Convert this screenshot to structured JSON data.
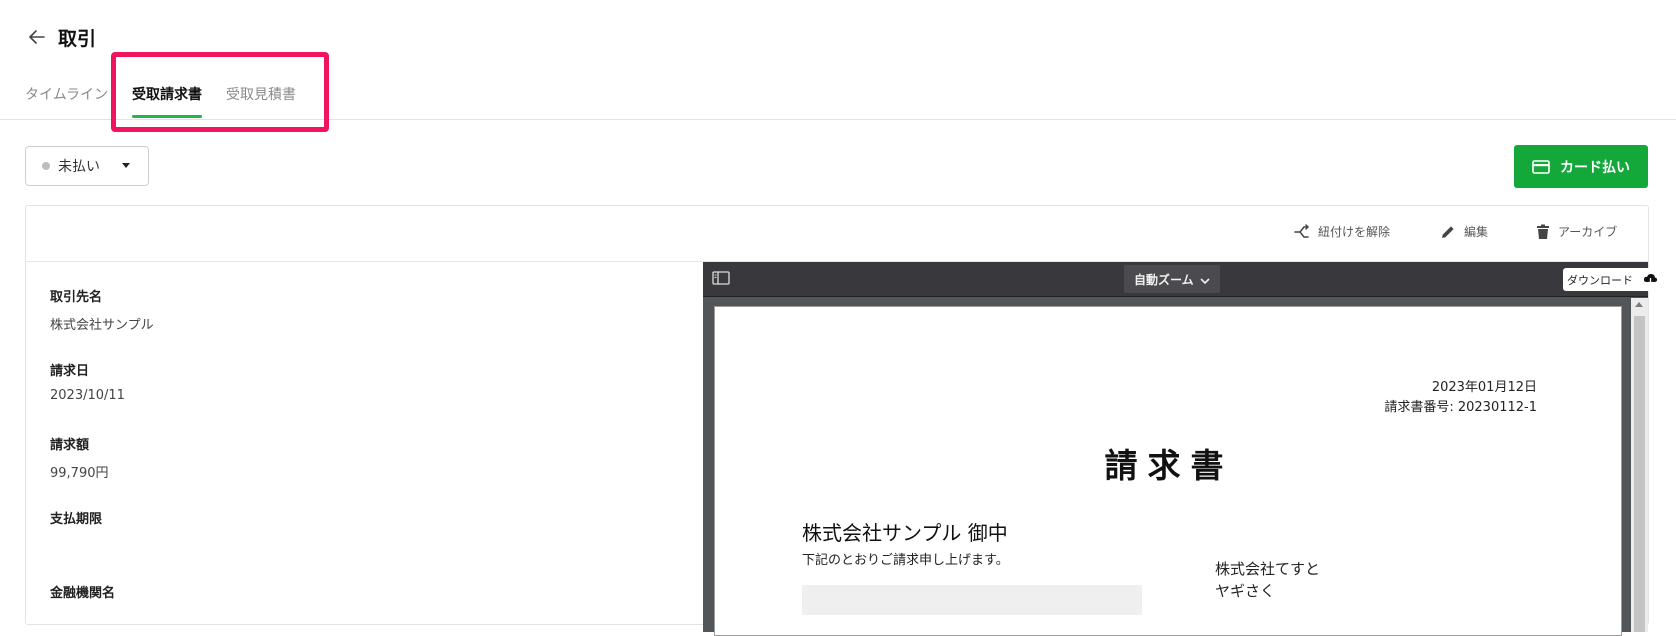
{
  "header": {
    "title": "取引"
  },
  "tabs": [
    {
      "label": "タイムライン",
      "active": false
    },
    {
      "label": "受取請求書",
      "active": true
    },
    {
      "label": "受取見積書",
      "active": false
    }
  ],
  "status_filter": {
    "value": "未払い"
  },
  "actions": {
    "card_pay": "カード払い"
  },
  "toolbar": {
    "unlink": "紐付けを解除",
    "edit": "編集",
    "archive": "アーカイブ"
  },
  "details": {
    "fields": [
      {
        "label": "取引先名",
        "value": "株式会社サンプル"
      },
      {
        "label": "請求日",
        "value": "2023/10/11"
      },
      {
        "label": "請求額",
        "value": "99,790円"
      },
      {
        "label": "支払期限",
        "value": ""
      },
      {
        "label": "金融機関名",
        "value": ""
      }
    ]
  },
  "viewer": {
    "zoom": "自動ズーム",
    "download": "ダウンロード"
  },
  "document": {
    "date": "2023年01月12日",
    "number": "請求書番号: 20230112-1",
    "title": "請求書",
    "recipient": "株式会社サンプル 御中",
    "intro": "下記のとおりご請求申し上げます。",
    "issuer": "株式会社てすと",
    "contact": "ヤギさく"
  },
  "colors": {
    "accent_green": "#14a83b",
    "tab_underline": "#1fb848",
    "highlight": "#f0145f",
    "viewer_bg": "#38383d"
  }
}
